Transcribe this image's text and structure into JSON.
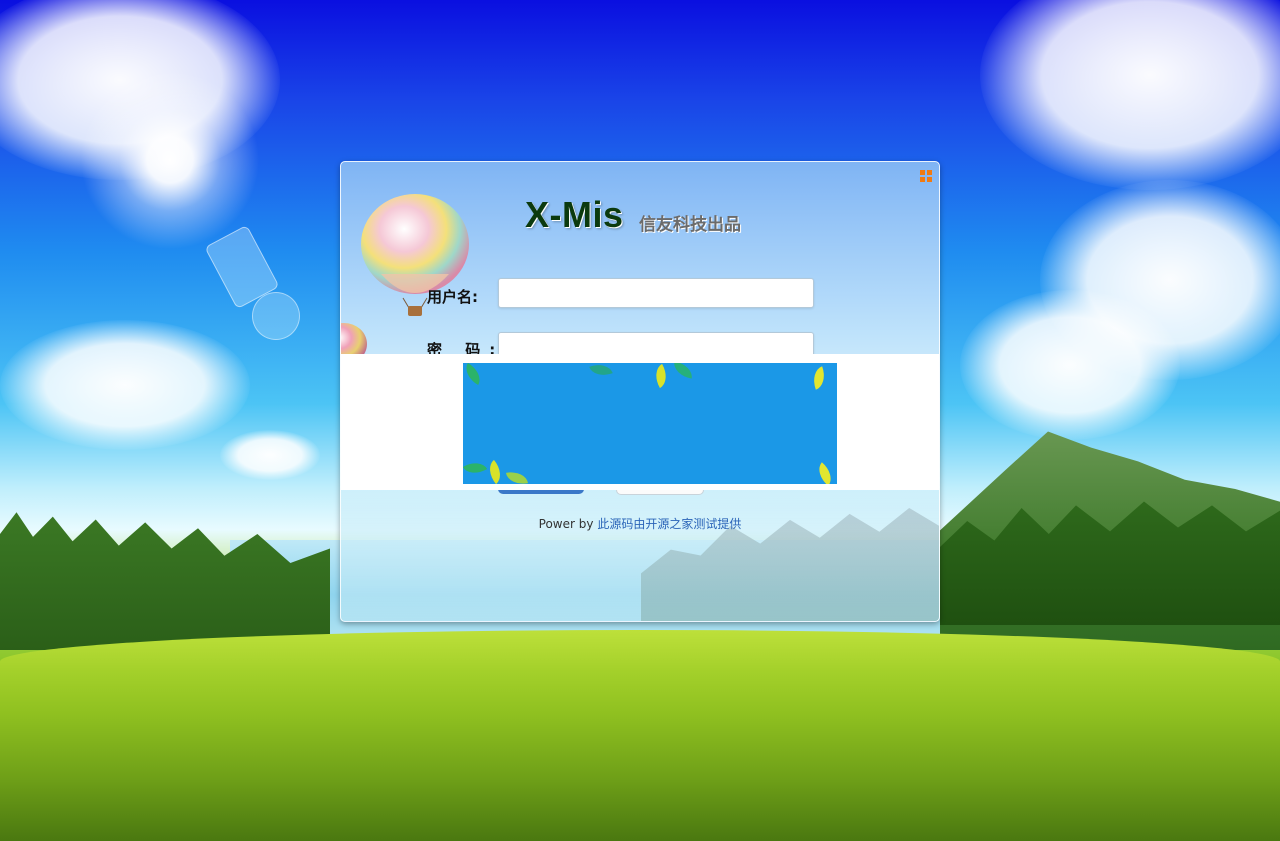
{
  "logo": {
    "name": "X-Mis",
    "tagline": "信友科技出品"
  },
  "form": {
    "username_label": "用户名:",
    "username_value": "",
    "password_label": "密  码:",
    "password_value": ""
  },
  "footer": {
    "prefix": "Power by",
    "link_text": "此源码由开源之家测试提供"
  },
  "colors": {
    "accent_orange": "#f07a12",
    "banner_blue": "#1b98e7",
    "login_button_blue": "#3a78c8",
    "link_blue": "#2a64b8"
  },
  "icons": [
    "grid-menu-icon",
    "hot-air-balloon-icon"
  ]
}
